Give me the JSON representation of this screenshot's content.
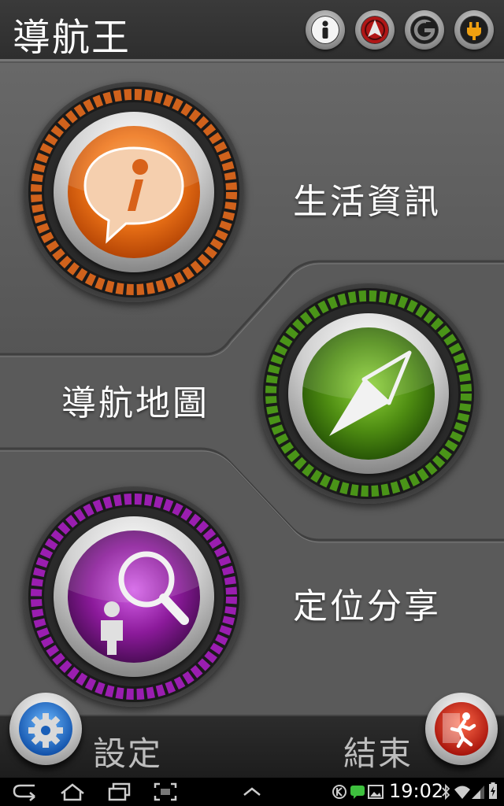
{
  "header": {
    "title": "導航王",
    "icons": [
      "info-icon",
      "recenter-icon",
      "gps-icon",
      "power-plug-icon"
    ]
  },
  "menu": {
    "items": [
      {
        "label": "生活資訊",
        "icon": "info-bubble-icon",
        "color": "#e06a1c"
      },
      {
        "label": "導航地圖",
        "icon": "compass-icon",
        "color": "#4d8a12"
      },
      {
        "label": "定位分享",
        "icon": "locate-person-icon",
        "color": "#8b1a9a"
      }
    ]
  },
  "footer": {
    "settings_label": "設定",
    "exit_label": "結束"
  },
  "status_bar": {
    "time": "19:02",
    "nav_icons": [
      "back-icon",
      "home-icon",
      "recent-apps-icon",
      "screenshot-icon",
      "chevron-up-icon"
    ],
    "status_icons": [
      "k-icon",
      "chat-icon",
      "image-icon",
      "bluetooth-icon",
      "wifi-icon",
      "signal-icon",
      "battery-icon"
    ]
  },
  "colors": {
    "background": "#575757",
    "header": "#333333",
    "accent_orange": "#e06a1c",
    "accent_green": "#4d8a12",
    "accent_purple": "#8b1a9a"
  }
}
